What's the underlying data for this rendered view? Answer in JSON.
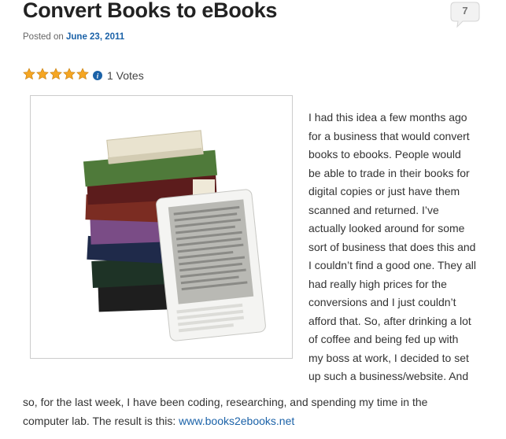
{
  "post": {
    "title": "Convert Books to eBooks",
    "comment_count": "7",
    "posted_on_label": "Posted on",
    "date": "June 23, 2011",
    "rating": {
      "stars_filled": 5,
      "stars_total": 5,
      "votes_text": "1 Votes"
    },
    "image_alt": "Stack of books with an e-reader",
    "body_side_lines": [
      "I had this idea a few months ago",
      "for a business that would convert",
      "books to ebooks. People would",
      "be able to trade in their books for",
      "digital copies or just have them",
      "scanned and returned. I’ve",
      "actually looked around for some",
      "sort of business that does this and",
      "I couldn’t find a good one. They all",
      "had really high prices for the",
      "conversions and I just couldn’t",
      "afford that. So, after drinking a lot",
      "of coffee and being fed up with",
      "my boss at work, I decided to set",
      "up such a business/website. And"
    ],
    "body_tail_line1": "so, for the last week, I have been coding, researching, and spending my time in the",
    "body_tail_line2_prefix": "computer lab. The result is this: ",
    "link_text": "www.books2ebooks.net"
  },
  "colors": {
    "link": "#1b62a8",
    "star": "#f5a623",
    "info": "#1b62a8"
  },
  "icons": {
    "star": "star-icon",
    "info": "info-icon",
    "comment": "speech-bubble-icon"
  }
}
